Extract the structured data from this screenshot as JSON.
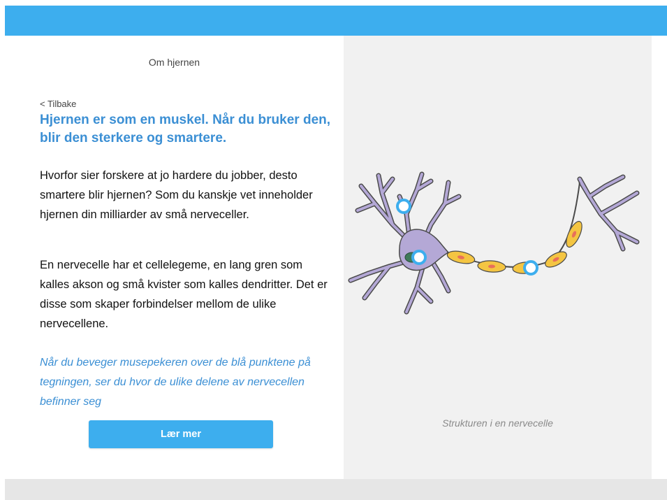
{
  "header": {
    "color": "#3daeee"
  },
  "left": {
    "section_title": "Om hjernen",
    "back_label": "< Tilbake",
    "headline": "Hjernen er som en muskel. Når du bruker den, blir den sterkere og smartere.",
    "paragraph1": "Hvorfor sier forskere at jo hardere du jobber, desto smartere blir hjernen? Som du kanskje vet inneholder hjernen din milliarder av små nerveceller.",
    "paragraph2": "En nervecelle har et cellelegeme, en lang gren som kalles akson og små kvister som kalles dendritter. Det er disse som skaper forbindelser mellom de ulike nervecellene.",
    "hint": "Når du beveger musepekeren over de blå punktene på tegningen, ser du hvor de ulike delene av nervecellen befinner seg",
    "button_label": "Lær mer"
  },
  "right": {
    "caption": "Strukturen i en nervecelle",
    "illustration": {
      "cell_color": "#b4a8d6",
      "outline_color": "#4a4a4a",
      "myelin_color": "#f4c542",
      "node_color": "#e8705a",
      "hotspot_color": "#3daeee",
      "hotspots": [
        "dendrite-hotspot",
        "nucleus-hotspot",
        "axon-hotspot"
      ]
    }
  }
}
